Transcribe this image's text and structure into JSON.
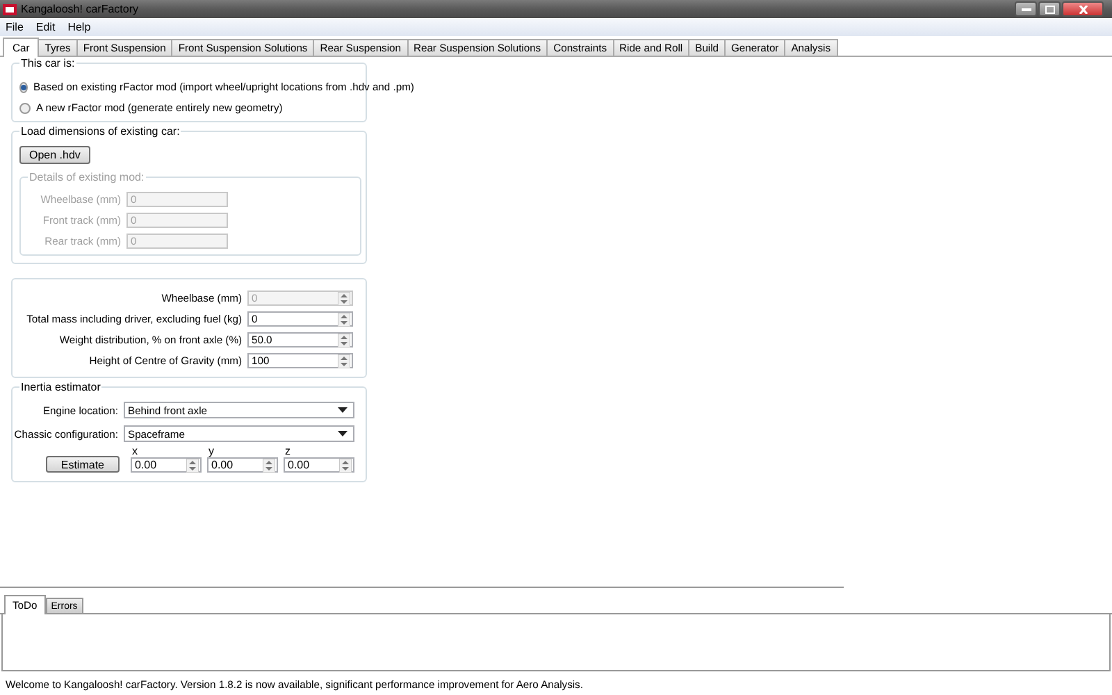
{
  "window": {
    "title": "Kangaloosh! carFactory"
  },
  "menu": [
    "File",
    "Edit",
    "Help"
  ],
  "tabs": [
    {
      "label": "Car",
      "selected": true
    },
    {
      "label": "Tyres",
      "selected": false
    },
    {
      "label": "Front Suspension",
      "selected": false
    },
    {
      "label": "Front Suspension Solutions",
      "selected": false
    },
    {
      "label": "Rear Suspension",
      "selected": false
    },
    {
      "label": "Rear Suspension Solutions",
      "selected": false
    },
    {
      "label": "Constraints",
      "selected": false
    },
    {
      "label": "Ride and Roll",
      "selected": false
    },
    {
      "label": "Build",
      "selected": false
    },
    {
      "label": "Generator",
      "selected": false
    },
    {
      "label": "Analysis",
      "selected": false
    }
  ],
  "car_type": {
    "title": "This car is:",
    "options": [
      {
        "label": "Based on existing rFactor mod (import wheel/upright locations from .hdv and .pm)",
        "selected": true
      },
      {
        "label": "A new rFactor mod (generate entirely new geometry)",
        "selected": false
      }
    ]
  },
  "load_dimensions": {
    "title": "Load dimensions of existing car:",
    "button": "Open .hdv",
    "details": {
      "title": "Details of existing mod:",
      "disabled": true,
      "fields": [
        {
          "label": "Wheelbase (mm)",
          "value": "0"
        },
        {
          "label": "Front track (mm)",
          "value": "0"
        },
        {
          "label": "Rear track (mm)",
          "value": "0"
        }
      ]
    }
  },
  "parameters": [
    {
      "label": "Wheelbase (mm)",
      "value": "0",
      "disabled": true
    },
    {
      "label": "Total mass including driver, excluding fuel (kg)",
      "value": "0",
      "disabled": false
    },
    {
      "label": "Weight distribution, % on front axle (%)",
      "value": "50.0",
      "disabled": false
    },
    {
      "label": "Height of Centre of Gravity (mm)",
      "value": "100",
      "disabled": false
    }
  ],
  "inertia": {
    "title": "Inertia estimator",
    "dropdowns": [
      {
        "label": "Engine location:",
        "value": "Behind front axle"
      },
      {
        "label": "Chassic configuration:",
        "value": "Spaceframe"
      }
    ],
    "button": "Estimate",
    "axes": [
      {
        "label": "x",
        "value": "0.00"
      },
      {
        "label": "y",
        "value": "0.00"
      },
      {
        "label": "z",
        "value": "0.00"
      }
    ]
  },
  "bottom_tabs": [
    {
      "label": "ToDo",
      "selected": true
    },
    {
      "label": "Errors",
      "selected": false
    }
  ],
  "status_bar": "Welcome to Kangaloosh! carFactory.  Version 1.8.2 is now available, significant performance improvement for Aero Analysis."
}
